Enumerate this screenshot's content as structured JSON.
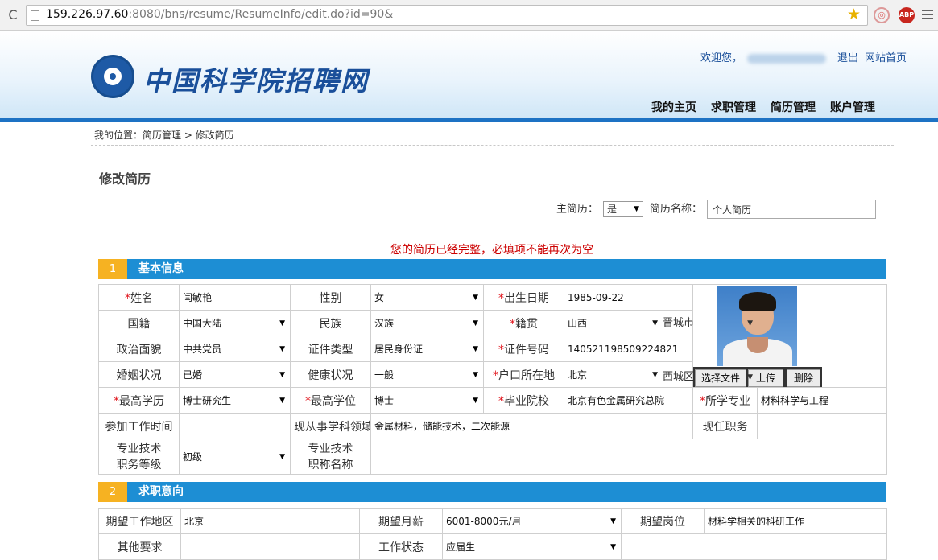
{
  "browser": {
    "url_host": "159.226.97.60",
    "url_rest": ":8080/bns/resume/ResumeInfo/edit.do?id=90&",
    "abp_label": "ABP"
  },
  "site": {
    "logo_text": "中国科学院招聘网",
    "welcome": "欢迎您，",
    "logout": "退出",
    "home_link": "网站首页",
    "nav": [
      "我的主页",
      "求职管理",
      "简历管理",
      "账户管理"
    ]
  },
  "page": {
    "breadcrumb": "我的位置：简历管理 > 修改简历",
    "title": "修改简历",
    "main_resume_label": "主简历：",
    "main_resume_value": "是",
    "resume_name_label": "简历名称：",
    "resume_name_value": "个人简历",
    "warning": "您的简历已经完整，必填项不能再次为空"
  },
  "section1": {
    "num": "1",
    "title": "基本信息",
    "name_label": "姓名",
    "name_value": "闫敏艳",
    "gender_label": "性别",
    "gender_value": "女",
    "birth_label": "出生日期",
    "birth_value": "1985-09-22",
    "nationality_label": "国籍",
    "nationality_value": "中国大陆",
    "ethnic_label": "民族",
    "ethnic_value": "汉族",
    "native_label": "籍贯",
    "native_province": "山西",
    "native_city": "晋城市",
    "political_label": "政治面貌",
    "political_value": "中共党员",
    "idtype_label": "证件类型",
    "idtype_value": "居民身份证",
    "idno_label": "证件号码",
    "idno_value": "140521198509224821",
    "marital_label": "婚姻状况",
    "marital_value": "已婚",
    "health_label": "健康状况",
    "health_value": "一般",
    "hukou_label": "户口所在地",
    "hukou_province": "北京",
    "hukou_city": "西城区",
    "edu_label": "最高学历",
    "edu_value": "博士研究生",
    "degree_label": "最高学位",
    "degree_value": "博士",
    "school_label": "毕业院校",
    "school_value": "北京有色金属研究总院",
    "major_label": "所学专业",
    "major_value": "材料科学与工程",
    "work_start_label": "参加工作时间",
    "work_start_value": "",
    "field_label": "现从事学科领域",
    "field_value": "金属材料，储能技术，二次能源",
    "position_label": "现任职务",
    "position_value": "",
    "tech_level_label_1": "专业技术",
    "tech_level_label_2": "职务等级",
    "tech_level_value": "初级",
    "tech_title_label_1": "专业技术",
    "tech_title_label_2": "职称名称",
    "tech_title_value": "",
    "btn_choose": "选择文件",
    "btn_upload": "上传",
    "btn_delete": "删除"
  },
  "section2": {
    "num": "2",
    "title": "求职意向",
    "area_label": "期望工作地区",
    "area_value": "北京",
    "salary_label": "期望月薪",
    "salary_value": "6001-8000元/月",
    "post_label": "期望岗位",
    "post_value": "材料学相关的科研工作",
    "other_label": "其他要求",
    "other_value": "",
    "status_label": "工作状态",
    "status_value": "应届生"
  },
  "colors": {
    "section_blue": "#1d8ed4",
    "section_num": "#f6b222",
    "warning_red": "#cc0000",
    "header_bar": "#1d72c4"
  }
}
